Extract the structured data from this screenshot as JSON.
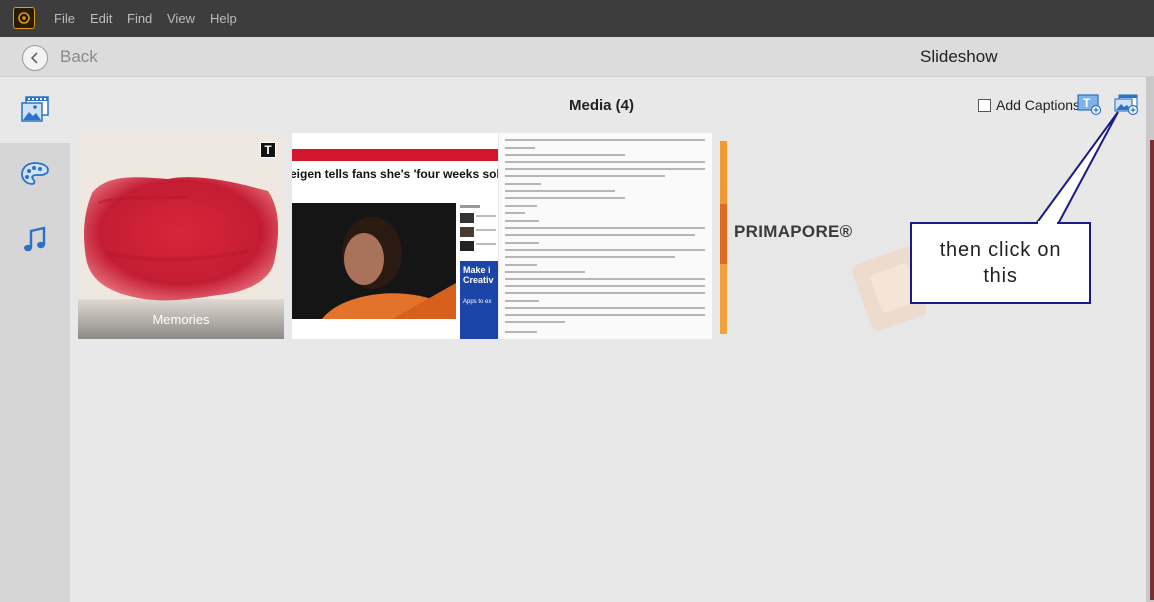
{
  "menu": [
    "File",
    "Edit",
    "Find",
    "View",
    "Help"
  ],
  "header": {
    "back_label": "Back",
    "title": "Slideshow"
  },
  "sidebar": {
    "items": [
      "media-icon",
      "theme-palette-icon",
      "music-icon"
    ]
  },
  "main": {
    "media_title": "Media (4)",
    "add_captions_label": "Add Captions",
    "add_captions_checked": false,
    "tools": [
      "add-text-slide-icon",
      "add-media-icon"
    ]
  },
  "thumbnails": [
    {
      "label": "Memories",
      "badge": "T"
    },
    {
      "headline": "eigen tells fans she's 'four weeks sobe"
    },
    {
      "kind": "document"
    },
    {
      "brand": "PRIMAPORE®"
    }
  ],
  "callout": {
    "text": "then click on this"
  },
  "colors": {
    "menubar": "#3d3d3d",
    "callout_border": "#1a1a8a",
    "news_red": "#d4162c"
  }
}
